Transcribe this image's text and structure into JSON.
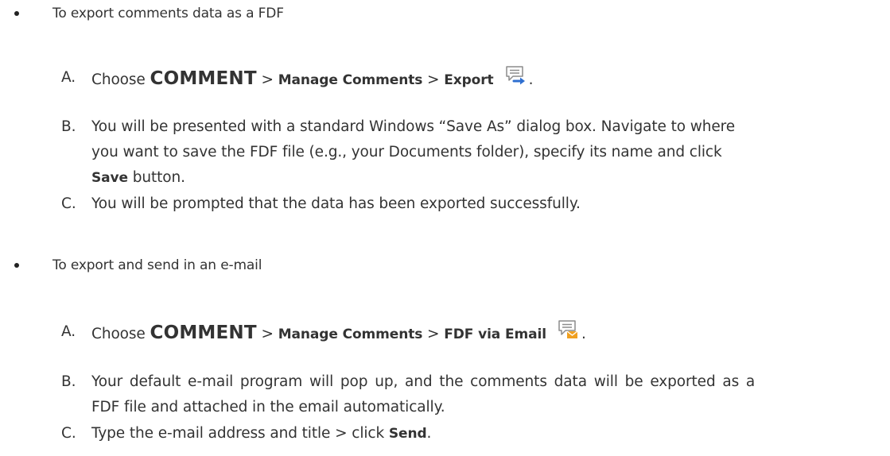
{
  "section1": {
    "bullet": "To export comments data as a FDF",
    "step_a": {
      "letter": "A.",
      "choose": "Choose",
      "tab": "COMMENT",
      "sep1": ">",
      "group": "Manage Comments",
      "sep2": ">",
      "command": "Export",
      "end": ".",
      "icon": "export-comments-icon"
    },
    "step_b": {
      "letter": "B.",
      "line1": "You will be presented with a standard Windows “Save As” dialog box. Navigate to where",
      "line2": "you want to save the FDF file (e.g., your Documents folder), specify its name and click",
      "save_label": "Save",
      "line3_rest": "button."
    },
    "step_c": {
      "letter": "C.",
      "text": "You will be prompted that the data has been exported successfully."
    }
  },
  "section2": {
    "bullet": "To export and send in an e-mail",
    "step_a": {
      "letter": "A.",
      "choose": "Choose",
      "tab": "COMMENT",
      "sep1": ">",
      "group": "Manage Comments",
      "sep2": ">",
      "command": "FDF via Email",
      "end": ".",
      "icon": "fdf-via-email-icon"
    },
    "step_b": {
      "letter": "B.",
      "line1": "Your default e-mail program will pop up, and the comments data will be exported as a",
      "line2": "FDF file and attached in the email automatically."
    },
    "step_c": {
      "letter": "C.",
      "text_before": "Type the e-mail address and title > click",
      "send_label": "Send",
      "end": "."
    }
  },
  "colors": {
    "text": "#333333",
    "icon_blue": "#2f6fd0",
    "icon_orange": "#f0a020",
    "icon_gray": "#8c8c8c"
  }
}
